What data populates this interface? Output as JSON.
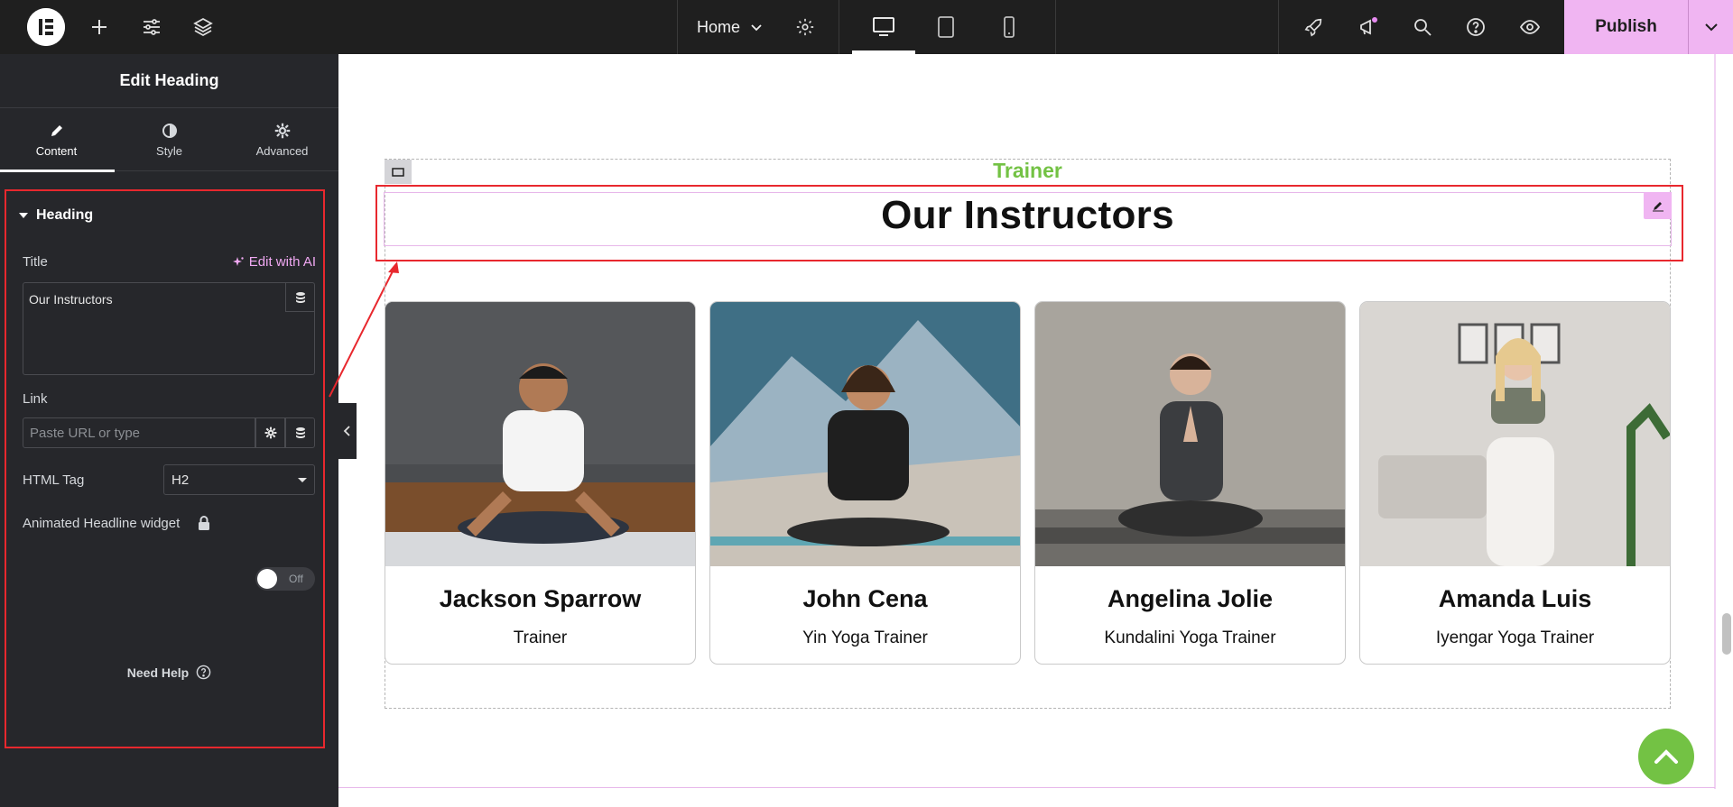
{
  "topbar": {
    "page_name": "Home",
    "publish_label": "Publish",
    "notification_color": "#e68bf0"
  },
  "panel": {
    "title": "Edit Heading",
    "tabs": [
      {
        "label": "Content",
        "icon": "pencil-icon",
        "active": true
      },
      {
        "label": "Style",
        "icon": "half-circle-icon",
        "active": false
      },
      {
        "label": "Advanced",
        "icon": "gear-icon",
        "active": false
      }
    ],
    "section_title": "Heading",
    "title_label": "Title",
    "edit_ai_label": "Edit with AI",
    "title_value": "Our Instructors",
    "link_label": "Link",
    "link_placeholder": "Paste URL or type",
    "html_tag_label": "HTML Tag",
    "html_tag_value": "H2",
    "animated_label": "Animated Headline widget",
    "toggle_label": "Off",
    "need_help": "Need Help"
  },
  "canvas": {
    "subtitle": "Trainer",
    "heading": "Our Instructors",
    "accent_color": "#73c244",
    "cards": [
      {
        "name": "Jackson Sparrow",
        "role": "Trainer"
      },
      {
        "name": "John Cena",
        "role": "Yin Yoga Trainer"
      },
      {
        "name": "Angelina Jolie",
        "role": "Kundalini Yoga Trainer"
      },
      {
        "name": "Amanda Luis",
        "role": "Iyengar Yoga Trainer"
      }
    ]
  }
}
